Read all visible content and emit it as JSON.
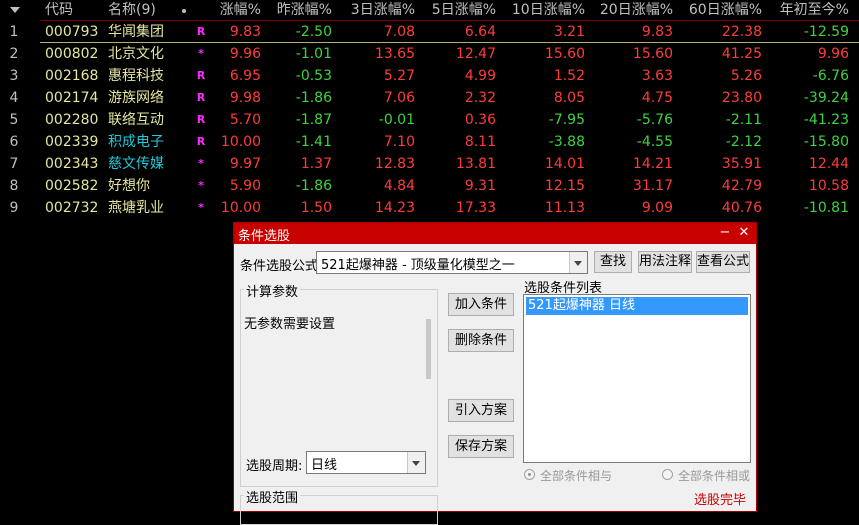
{
  "table": {
    "headers": [
      "代码",
      "名称(9)",
      "涨幅%",
      "昨涨幅%",
      "3日涨幅%",
      "5日涨幅%",
      "10日涨幅%",
      "20日涨幅%",
      "60日涨幅%",
      "年初至今%"
    ],
    "rows": [
      {
        "idx": "1",
        "code": "000793",
        "name": "华闻集团",
        "name_color": "white",
        "flag": "R",
        "vals": [
          "9.83",
          "-2.50",
          "7.08",
          "6.64",
          "3.21",
          "9.83",
          "22.38",
          "-12.59"
        ]
      },
      {
        "idx": "2",
        "code": "000802",
        "name": "北京文化",
        "name_color": "white",
        "flag": "*",
        "vals": [
          "9.96",
          "-1.01",
          "13.65",
          "12.47",
          "15.60",
          "15.60",
          "41.25",
          "9.96"
        ]
      },
      {
        "idx": "3",
        "code": "002168",
        "name": "惠程科技",
        "name_color": "white",
        "flag": "R",
        "vals": [
          "6.95",
          "-0.53",
          "5.27",
          "4.99",
          "1.52",
          "3.63",
          "5.26",
          "-6.76"
        ]
      },
      {
        "idx": "4",
        "code": "002174",
        "name": "游族网络",
        "name_color": "white",
        "flag": "R",
        "vals": [
          "9.98",
          "-1.86",
          "7.06",
          "2.32",
          "8.05",
          "4.75",
          "23.80",
          "-39.24"
        ]
      },
      {
        "idx": "5",
        "code": "002280",
        "name": "联络互动",
        "name_color": "white",
        "flag": "R",
        "vals": [
          "5.70",
          "-1.87",
          "-0.01",
          "0.36",
          "-7.95",
          "-5.76",
          "-2.11",
          "-41.23"
        ]
      },
      {
        "idx": "6",
        "code": "002339",
        "name": "积成电子",
        "name_color": "cyan",
        "flag": "R",
        "vals": [
          "10.00",
          "-1.41",
          "7.10",
          "8.11",
          "-3.88",
          "-4.55",
          "-2.12",
          "-15.80"
        ]
      },
      {
        "idx": "7",
        "code": "002343",
        "name": "慈文传媒",
        "name_color": "cyan",
        "flag": "*",
        "vals": [
          "9.97",
          "1.37",
          "12.83",
          "13.81",
          "14.01",
          "14.21",
          "35.91",
          "12.44"
        ]
      },
      {
        "idx": "8",
        "code": "002582",
        "name": "好想你",
        "name_color": "white",
        "flag": "*",
        "vals": [
          "5.90",
          "-1.86",
          "4.84",
          "9.31",
          "12.15",
          "31.17",
          "42.79",
          "10.58"
        ]
      },
      {
        "idx": "9",
        "code": "002732",
        "name": "燕塘乳业",
        "name_color": "white",
        "flag": "*",
        "vals": [
          "10.00",
          "1.50",
          "14.23",
          "17.33",
          "11.13",
          "9.09",
          "40.76",
          "-10.81"
        ]
      }
    ]
  },
  "dialog": {
    "title": "条件选股",
    "formula_label": "条件选股公式",
    "formula_value": "521起爆神器 - 顶级量化模型之一",
    "find_btn": "查找",
    "usage_btn": "用法注释",
    "view_btn": "查看公式",
    "params_group": "计算参数",
    "params_text": "无参数需要设置",
    "add_btn": "加入条件",
    "del_btn": "删除条件",
    "import_btn": "引入方案",
    "save_btn": "保存方案",
    "list_label": "选股条件列表",
    "list_items": [
      "521起爆神器  日线"
    ],
    "period_label": "选股周期:",
    "period_value": "日线",
    "and_label": "全部条件相与",
    "or_label": "全部条件相或",
    "range_group": "选股范围",
    "run_btn": "选股完毕",
    "colors": {
      "accent": "#c80000",
      "up": "#ff3b3b",
      "down": "#3fd33f",
      "code": "#e6e6a0",
      "name_alt": "#20c8d8"
    }
  }
}
